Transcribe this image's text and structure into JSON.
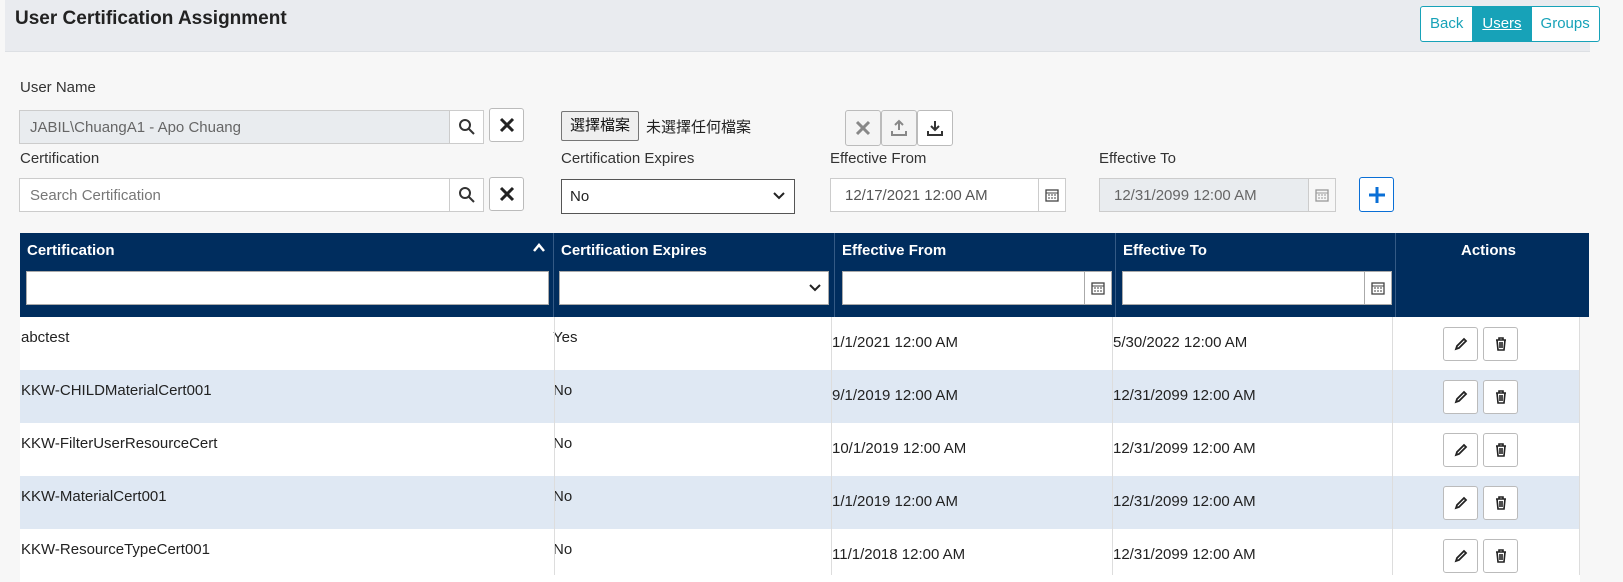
{
  "header": {
    "title": "User Certification Assignment",
    "nav": {
      "back": "Back",
      "users": "Users",
      "groups": "Groups"
    }
  },
  "form": {
    "user_name_label": "User Name",
    "user_name_value": "JABIL\\ChuangA1 - Apo Chuang",
    "file_button": "選擇檔案",
    "file_status": "未選擇任何檔案",
    "certification_label": "Certification",
    "certification_placeholder": "Search Certification",
    "expires_label": "Certification Expires",
    "expires_value": "No",
    "effective_from_label": "Effective From",
    "effective_from_value": "12/17/2021 12:00 AM",
    "effective_to_label": "Effective To",
    "effective_to_value": "12/31/2099 12:00 AM"
  },
  "table": {
    "columns": {
      "certification": "Certification",
      "expires": "Certification Expires",
      "effective_from": "Effective From",
      "effective_to": "Effective To",
      "actions": "Actions"
    },
    "sort": {
      "column": "certification",
      "direction": "ascending"
    },
    "rows": [
      {
        "certification": "abctest",
        "expires": "Yes",
        "from": "1/1/2021 12:00 AM",
        "to": "5/30/2022 12:00 AM"
      },
      {
        "certification": "KKW-CHILDMaterialCert001",
        "expires": "No",
        "from": "9/1/2019 12:00 AM",
        "to": "12/31/2099 12:00 AM"
      },
      {
        "certification": "KKW-FilterUserResourceCert",
        "expires": "No",
        "from": "10/1/2019 12:00 AM",
        "to": "12/31/2099 12:00 AM"
      },
      {
        "certification": "KKW-MaterialCert001",
        "expires": "No",
        "from": "1/1/2019 12:00 AM",
        "to": "12/31/2099 12:00 AM"
      },
      {
        "certification": "KKW-ResourceTypeCert001",
        "expires": "No",
        "from": "11/1/2018 12:00 AM",
        "to": "12/31/2099 12:00 AM"
      }
    ]
  },
  "icons": {
    "search": "search-icon",
    "clear": "close-icon",
    "upload": "upload-icon",
    "download": "download-icon",
    "calendar": "calendar-icon",
    "add": "plus-icon",
    "edit": "pencil-icon",
    "delete": "trash-icon"
  },
  "colors": {
    "header_bg": "#002d5e",
    "accent": "#17a2b8",
    "add": "#0a6fd6",
    "alt_row": "#dfe8f3"
  }
}
